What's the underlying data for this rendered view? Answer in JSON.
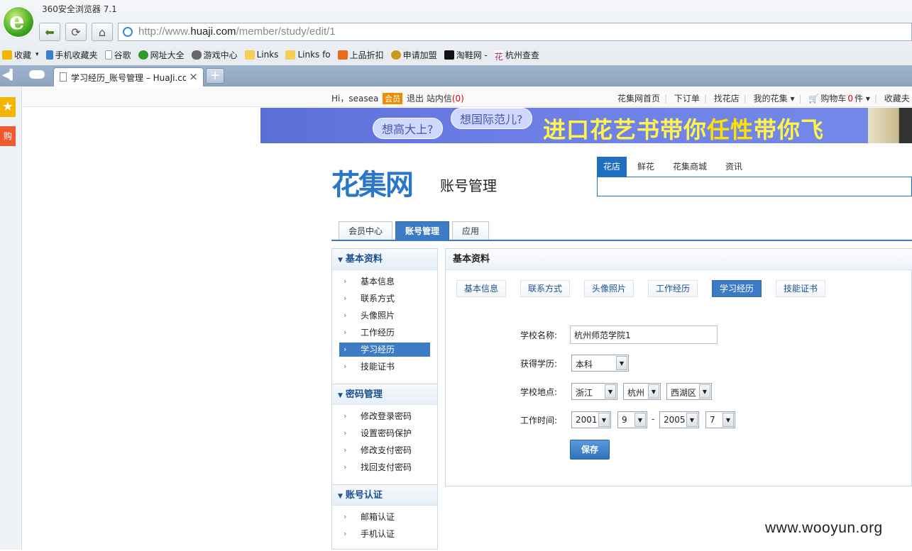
{
  "browser": {
    "title": "360安全浏览器 7.1",
    "url_prefix": "http://www.",
    "url_domain": "huaji.com",
    "url_path": "/member/study/edit/1",
    "bookmarks": [
      "收藏",
      "手机收藏夹",
      "谷歌",
      "网址大全",
      "游戏中心",
      "Links",
      "Links fo",
      "上品折扣",
      "申请加盟",
      "淘鞋网 -",
      "杭州查查"
    ],
    "tab_title": "学习经历_账号管理 – HuaJi.com",
    "tab_close": "×",
    "new_tab": "+",
    "accent": "#3c7cc4"
  },
  "sidebar": {
    "star": "★",
    "buy": "购"
  },
  "topbar": {
    "greeting": "Hi，seasea",
    "vip": "会员",
    "logout": "退出",
    "messages": "站内信",
    "message_count": "(0)",
    "nav": [
      "花集网首页",
      "下订单",
      "找花店",
      "我的花集 ▾",
      "购物车",
      "0",
      "件 ▾",
      "收藏夫"
    ]
  },
  "banner": {
    "bubble1": "想高大上?",
    "bubble2": "想国际范儿?",
    "slogan_a": "进口花艺书带你",
    "slogan_b": "任性",
    "slogan_c": "带你飞"
  },
  "header": {
    "logo": "花集网",
    "subtitle": "账号管理",
    "search_tabs": [
      "花店",
      "鲜花",
      "花集商城",
      "资讯"
    ]
  },
  "main_tabs": [
    "会员中心",
    "账号管理",
    "应用"
  ],
  "left_menu": {
    "sections": [
      {
        "title": "基本资料",
        "items": [
          "基本信息",
          "联系方式",
          "头像照片",
          "工作经历",
          "学习经历",
          "技能证书"
        ]
      },
      {
        "title": "密码管理",
        "items": [
          "修改登录密码",
          "设置密码保护",
          "修改支付密码",
          "找回支付密码"
        ]
      },
      {
        "title": "账号认证",
        "items": [
          "邮箱认证",
          "手机认证"
        ]
      }
    ]
  },
  "panel": {
    "title": "基本资料",
    "subtabs": [
      "基本信息",
      "联系方式",
      "头像照片",
      "工作经历",
      "学习经历",
      "技能证书"
    ],
    "form": {
      "school_label": "学校名称:",
      "school_value": "杭州师范学院1",
      "degree_label": "获得学历:",
      "degree_value": "本科",
      "location_label": "学校地点:",
      "province": "浙江",
      "city": "杭州",
      "district": "西湖区",
      "time_label": "工作时间:",
      "start_year": "2001",
      "start_month": "9",
      "dash": "-",
      "end_year": "2005",
      "end_month": "7",
      "save": "保存"
    }
  },
  "watermark": "www.wooyun.org"
}
